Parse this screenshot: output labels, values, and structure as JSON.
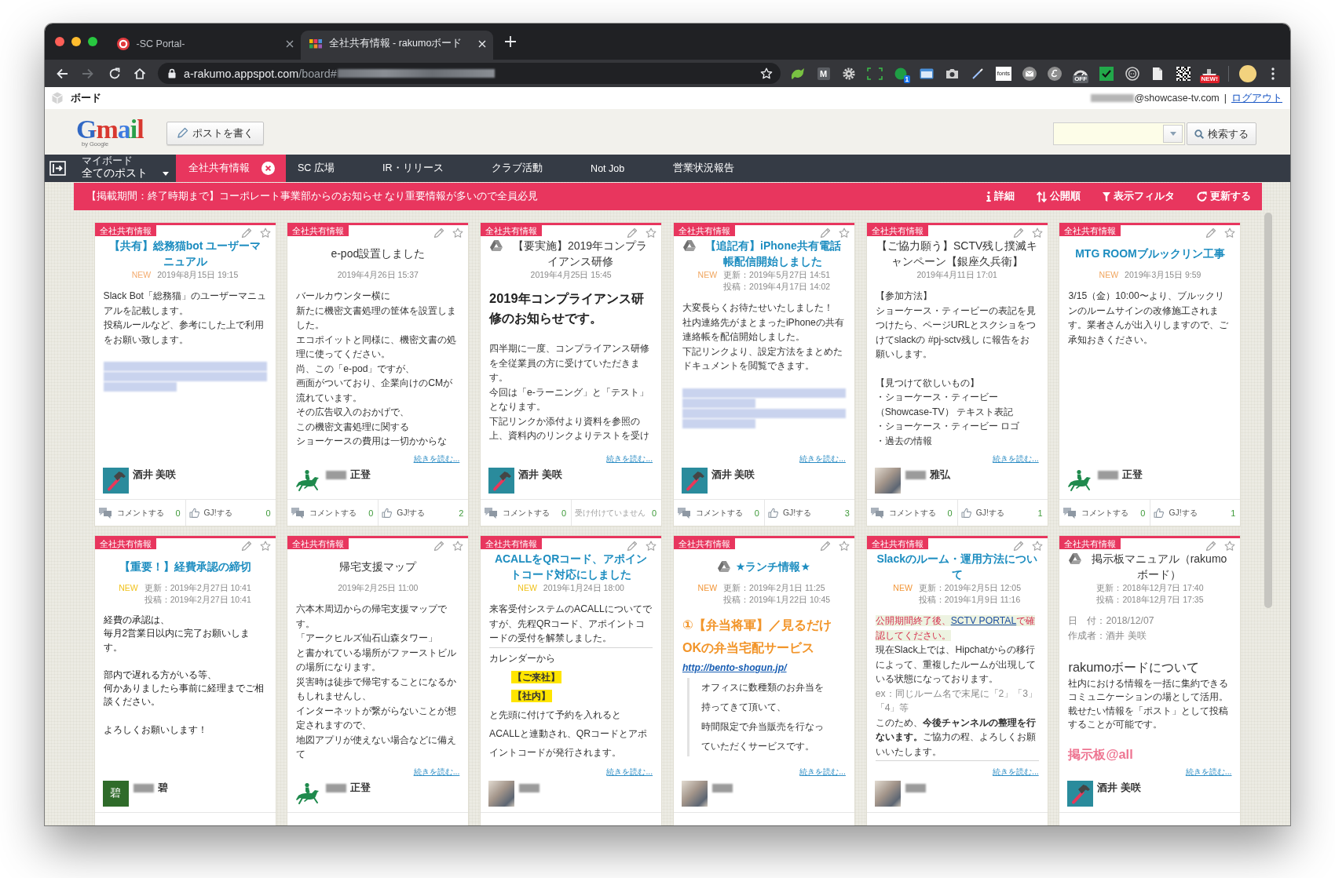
{
  "browser": {
    "tabs": [
      {
        "kind": "portal",
        "title": "-SC Portal-",
        "selected": false
      },
      {
        "kind": "grid",
        "title": "全社共有情報 - rakumoボード",
        "selected": true
      }
    ],
    "forward_disabled": true,
    "address": {
      "host": "a-rakumo.appspot.com",
      "path": "/board#",
      "redacted": true
    },
    "extensions": [
      {
        "kind": "leaf"
      },
      {
        "kind": "letter",
        "text": "M"
      },
      {
        "kind": "gear"
      },
      {
        "kind": "frame"
      },
      {
        "kind": "dot",
        "badge": "1"
      },
      {
        "kind": "window"
      },
      {
        "kind": "camera"
      },
      {
        "kind": "pen"
      },
      {
        "kind": "label",
        "text": "fonts"
      },
      {
        "kind": "mail"
      },
      {
        "kind": "swirl"
      },
      {
        "kind": "gauge",
        "badge": "OFF"
      },
      {
        "kind": "check"
      },
      {
        "kind": "ring"
      },
      {
        "kind": "document"
      },
      {
        "kind": "qr"
      },
      {
        "kind": "boat",
        "badge": "NEW!"
      }
    ]
  },
  "header": {
    "title": "ボード",
    "redacted": true,
    "account": "@showcase-tv.com",
    "separator": "|",
    "logout": "ログアウト"
  },
  "toolbar": {
    "logo": "Gmail",
    "logo_sub": "by Google",
    "compose": "ポストを書く",
    "search_button": "検索する"
  },
  "nav": {
    "board_caption": "マイボード",
    "board": "全てのポスト",
    "tabs": [
      {
        "label": "全社共有情報",
        "selected": true
      },
      {
        "label": "SC 広場",
        "selected": false
      },
      {
        "label": "IR・リリース",
        "selected": false
      },
      {
        "label": "クラブ活動",
        "selected": false
      },
      {
        "label": "Not Job",
        "selected": false
      },
      {
        "label": "営業状況報告",
        "selected": false
      }
    ]
  },
  "banner": {
    "text": "【掲載期間：終了時期まで】コーポレート事業部からのお知らせ なり重要情報が多いので全員必見",
    "actions": [
      {
        "kind": "info",
        "label": "詳細"
      },
      {
        "kind": "sort",
        "label": "公開順"
      },
      {
        "kind": "filter",
        "label": "表示フィルタ"
      },
      {
        "kind": "refresh",
        "label": "更新する"
      }
    ]
  },
  "posts": [
    {
      "tag": "全社共有情報",
      "title": "【共有】総務猫bot ユーザーマニュアル",
      "unread": true,
      "new_badge": {
        "text": "NEW",
        "color": "#f3ab6e"
      },
      "dates": [
        "2019年8月15日 19:15"
      ],
      "body": [
        {
          "kind": "text",
          "text": "Slack Bot「総務猫」のユーザーマニュアルを記載します。"
        },
        {
          "kind": "text",
          "text": "投稿ルールなど、参考にした上で利用をお願い致します。"
        },
        {
          "kind": "gap"
        },
        {
          "kind": "redacted",
          "short": false
        },
        {
          "kind": "redacted",
          "short": false
        },
        {
          "kind": "redacted",
          "short": true
        }
      ],
      "author": {
        "avatar": {
          "kind": "hammer"
        },
        "redacted": false,
        "name": "酒井 美咲"
      },
      "footer": {
        "comment": "コメントする",
        "comment_count": "0",
        "gj": "GJ!する",
        "gj_count": "0",
        "gj_disabled": false
      }
    },
    {
      "tag": "全社共有情報",
      "title": "e-pod設置しました",
      "unread": false,
      "dates": [
        "2019年4月26日 15:37"
      ],
      "body": [
        {
          "kind": "text",
          "text": "バールカウンター横に"
        },
        {
          "kind": "text",
          "text": "新たに機密文書処理の筐体を設置しました。"
        },
        {
          "kind": "text",
          "text": "エコポイットと同様に、機密文書の処理に使ってください。"
        },
        {
          "kind": "text",
          "text": "尚、この「e-pod」ですが、"
        },
        {
          "kind": "text",
          "text": "画面がついており、企業向けのCMが流れています。"
        },
        {
          "kind": "text",
          "text": "その広告収入のおかげで、"
        },
        {
          "kind": "text",
          "text": "この機密文書処理に関する"
        },
        {
          "kind": "text",
          "text": "ショーケースの費用は一切かからな"
        }
      ],
      "read_more": "続きを読む...",
      "author": {
        "avatar": {
          "kind": "rider"
        },
        "redacted": true,
        "name": "正登"
      },
      "footer": {
        "comment": "コメントする",
        "comment_count": "0",
        "gj": "GJ!する",
        "gj_count": "2",
        "gj_disabled": false
      }
    },
    {
      "tag": "全社共有情報",
      "title": "【要実施】2019年コンプライアンス研修",
      "title_icon": {
        "kind": "triangle"
      },
      "unread": false,
      "dates": [
        "2019年4月25日 15:45"
      ],
      "body": [
        {
          "kind": "lead",
          "text": "2019年コンプライアンス研修のお知らせです。"
        },
        {
          "kind": "text",
          "text": "四半期に一度、コンプライアンス研修を全従業員の方に受けていただきます。"
        },
        {
          "kind": "text",
          "text": "今回は「e-ラーニング」と「テスト」となります。"
        },
        {
          "kind": "text",
          "text": "下記リンクか添付より資料を参照の上、資料内のリンクよりテストを受け"
        }
      ],
      "read_more": "続きを読む...",
      "author": {
        "avatar": {
          "kind": "hammer"
        },
        "redacted": false,
        "name": "酒井 美咲"
      },
      "footer": {
        "comment": "コメントする",
        "comment_count": "0",
        "gj": "受け付けていません",
        "gj_count": "0",
        "gj_disabled": true
      }
    },
    {
      "tag": "全社共有情報",
      "title": "【追記有】iPhone共有電話帳配信開始しました",
      "title_icon": {
        "kind": "triangle"
      },
      "unread": true,
      "new_badge": {
        "text": "NEW",
        "color": "#f0a55e"
      },
      "dates": [
        "更新：2019年5月27日 14:51",
        "投稿：2019年4月17日 14:02"
      ],
      "body": [
        {
          "kind": "text",
          "text": "大変長らくお待たせいたしました！"
        },
        {
          "kind": "text",
          "text": "社内連絡先がまとまったiPhoneの共有連絡帳を配信開始しました。"
        },
        {
          "kind": "text",
          "text": "下記リンクより、設定方法をまとめたドキュメントを閲覧できます。"
        },
        {
          "kind": "gap"
        },
        {
          "kind": "redacted",
          "short": false
        },
        {
          "kind": "redacted",
          "short": true
        },
        {
          "kind": "redacted",
          "short": false
        },
        {
          "kind": "redacted",
          "short": true
        }
      ],
      "read_more": "続きを読む...",
      "author": {
        "avatar": {
          "kind": "hammer"
        },
        "redacted": false,
        "name": "酒井 美咲"
      },
      "footer": {
        "comment": "コメントする",
        "comment_count": "0",
        "gj": "GJ!する",
        "gj_count": "3",
        "gj_disabled": false
      }
    },
    {
      "tag": "全社共有情報",
      "title": "【ご協力願う】SCTV残し撲滅キャンペーン【銀座久兵衛】",
      "unread": false,
      "dates": [
        "2019年4月11日 17:01"
      ],
      "body": [
        {
          "kind": "text",
          "text": "【参加方法】"
        },
        {
          "kind": "text",
          "text": "ショーケース・ティービーの表記を見つけたら、ページURLとスクショをつけてslackの #pj-sctv残し に報告をお願いします。"
        },
        {
          "kind": "gap"
        },
        {
          "kind": "text",
          "text": "【見つけて欲しいもの】"
        },
        {
          "kind": "text",
          "text": "・ショーケース・ティービー（Showcase-TV） テキスト表記"
        },
        {
          "kind": "text",
          "text": "・ショーケース・ティービー ロゴ"
        },
        {
          "kind": "text",
          "text": "・過去の情報"
        }
      ],
      "read_more": "続きを読む...",
      "author": {
        "avatar": {
          "kind": "photo"
        },
        "redacted": true,
        "name": "雅弘"
      },
      "footer": {
        "comment": "コメントする",
        "comment_count": "0",
        "gj": "GJ!する",
        "gj_count": "1",
        "gj_disabled": false
      }
    },
    {
      "tag": "全社共有情報",
      "title": "MTG ROOMブルックリン工事",
      "unread": true,
      "new_badge": {
        "text": "NEW",
        "color": "#f0a55e"
      },
      "dates": [
        "2019年3月15日 9:59"
      ],
      "body": [
        {
          "kind": "text",
          "text": "3/15（金）10:00〜より、ブルックリンのルームサインの改修施工されます。業者さんが出入りしますので、ご承知おきください。"
        }
      ],
      "author": {
        "avatar": {
          "kind": "rider"
        },
        "redacted": true,
        "name": "正登"
      },
      "footer": {
        "comment": "コメントする",
        "comment_count": "0",
        "gj": "GJ!する",
        "gj_count": "1",
        "gj_disabled": false
      }
    },
    {
      "tag": "全社共有情報",
      "title": "【重要！】経費承認の締切",
      "unread": true,
      "new_badge": {
        "text": "NEW",
        "color": "#f0c21c"
      },
      "dates": [
        "更新：2019年2月27日 10:41",
        "投稿：2019年2月27日 10:41"
      ],
      "body": [
        {
          "kind": "small",
          "text": "経費の承認は、"
        },
        {
          "kind": "small",
          "text": "毎月2営業日以内に完了お願いします。"
        },
        {
          "kind": "gap"
        },
        {
          "kind": "small",
          "text": "部内で遅れる方がいる等、"
        },
        {
          "kind": "small",
          "text": "何かありましたら事前に経理までご相談ください。"
        },
        {
          "kind": "gap"
        },
        {
          "kind": "small",
          "text": "よろしくお願いします！"
        }
      ],
      "author": {
        "avatar": {
          "kind": "initial",
          "text": "碧"
        },
        "redacted": true,
        "name": "碧"
      }
    },
    {
      "tag": "全社共有情報",
      "title": "帰宅支援マップ",
      "unread": false,
      "dates": [
        "2019年2月25日 11:00"
      ],
      "body": [
        {
          "kind": "text",
          "text": "六本木周辺からの帰宅支援マップです。"
        },
        {
          "kind": "text",
          "text": "「アークヒルズ仙石山森タワー」"
        },
        {
          "kind": "text",
          "text": "と書かれている場所がファーストビルの場所になります。"
        },
        {
          "kind": "text",
          "text": "災害時は徒歩で帰宅することになるかもしれませんし、"
        },
        {
          "kind": "text",
          "text": "インターネットが繋がらないことが想定されますので、"
        },
        {
          "kind": "text",
          "text": "地図アプリが使えない場合などに備えて"
        }
      ],
      "read_more": "続きを読む...",
      "author": {
        "avatar": {
          "kind": "rider"
        },
        "redacted": true,
        "name": "正登"
      }
    },
    {
      "tag": "全社共有情報",
      "title": "ACALLをQRコード、アポイントコード対応にしました",
      "unread": true,
      "new_badge": {
        "text": "NEW",
        "color": "#f0c21c"
      },
      "dates": [
        "2019年1月24日 18:00"
      ],
      "body": [
        {
          "kind": "text",
          "text": "来客受付システムのACALLについてですが、先程QRコード、アポイントコードの受付を解禁しました。"
        },
        {
          "kind": "rule"
        },
        {
          "kind": "spaced",
          "text": "カレンダーから"
        },
        {
          "kind": "highlight",
          "text": "【ご来社】"
        },
        {
          "kind": "highlight",
          "text": "【社内】"
        },
        {
          "kind": "spaced",
          "text": "と先頭に付けて予約を入れると"
        },
        {
          "kind": "spaced",
          "text": "ACALLと連動され、QRコードとアポイントコードが発行されます。"
        }
      ],
      "read_more": "続きを読む...",
      "author": {
        "avatar": {
          "kind": "photo"
        },
        "redacted": true
      }
    },
    {
      "tag": "全社共有情報",
      "title": "★ランチ情報★",
      "title_icon": {
        "kind": "triangle"
      },
      "unread": true,
      "new_badge": {
        "text": "NEW",
        "color": "#f29638"
      },
      "dates": [
        "更新：2019年2月1日 11:25",
        "投稿：2019年1月22日 10:45"
      ],
      "body": [
        {
          "kind": "promo",
          "text": "①【弁当将軍】／見るだけOKの弁当宅配サービス"
        },
        {
          "kind": "url",
          "text": "http://bento-shogun.jp/"
        },
        {
          "kind": "quote",
          "lines": [
            "オフィスに数種類のお弁当を",
            "持ってきて頂いて、",
            "時間限定で弁当販売を行なっていただくサービスです。"
          ]
        }
      ],
      "read_more": "続きを読む...",
      "author": {
        "avatar": {
          "kind": "photo"
        },
        "redacted": true
      }
    },
    {
      "tag": "全社共有情報",
      "title": "Slackのルーム・運用方法について",
      "unread": true,
      "new_badge": {
        "text": "NEW",
        "color": "#f29638"
      },
      "dates": [
        "更新：2019年2月5日 12:05",
        "投稿：2019年1月9日 11:16"
      ],
      "body": [
        {
          "kind": "notice",
          "before": "公開期間終了後、",
          "link": "SCTV PORTAL",
          "after": "で確認してください。"
        },
        {
          "kind": "text",
          "text": "現在Slack上では、Hipchatからの移行によって、重複したルームが出現している状態になっております。"
        },
        {
          "kind": "muted",
          "text": "ex：同じルーム名で末尾に「2」「3」「4」等"
        },
        {
          "kind": "text",
          "text": "このため、**今後チャンネルの整理を行ないます。**ご協力の程、よろしくお願いいたします。"
        },
        {
          "kind": "rule"
        }
      ],
      "read_more": "続きを読む...",
      "author": {
        "avatar": {
          "kind": "photo"
        },
        "redacted": true
      }
    },
    {
      "tag": "全社共有情報",
      "title": "掲示板マニュアル（rakumoボード）",
      "title_icon": {
        "kind": "triangle"
      },
      "unread": false,
      "dates": [
        "更新：2018年12月7日 17:40",
        "投稿：2018年12月7日 17:35"
      ],
      "body": [
        {
          "kind": "muted",
          "text": "日　付：2018/12/07"
        },
        {
          "kind": "muted",
          "text": "作成者：酒井 美咲"
        },
        {
          "kind": "gap"
        },
        {
          "kind": "heading",
          "text": "rakumoボードについて"
        },
        {
          "kind": "tight",
          "text": "社内における情報を一括に集約できるコミュニケーションの場として活用。載せたい情報を「ポスト」として投稿することが可能です。"
        },
        {
          "kind": "gap"
        },
        {
          "kind": "accent",
          "text": "掲示板@all"
        }
      ],
      "read_more": "続きを読む...",
      "author": {
        "avatar": {
          "kind": "hammer"
        },
        "redacted": false,
        "name": "酒井 美咲"
      }
    }
  ]
}
